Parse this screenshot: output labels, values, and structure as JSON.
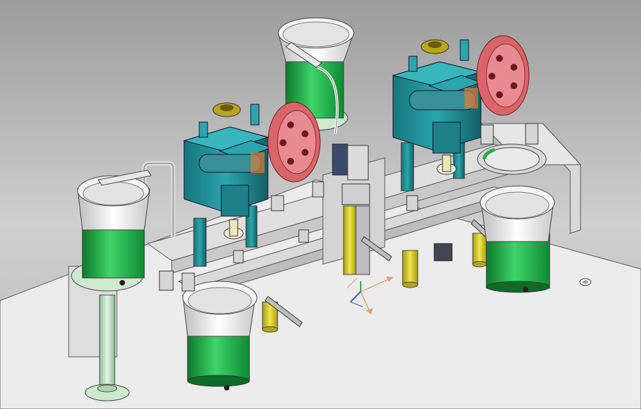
{
  "viewport": {
    "background_top": "#9c9c9c",
    "background_bottom": "#b9b9b9"
  },
  "colors": {
    "base_plate": "#ececec",
    "frame_rail": "#dcdcdc",
    "bowl_green": "#22b84a",
    "bowl_rim": "#f2f2f2",
    "press_body": "#1f8f96",
    "flywheel": "#d9646a",
    "cylinder_yellow": "#e0d22a",
    "pale_green": "#bfe3c4"
  },
  "triad": {
    "x_axis_color": "#d9a27a",
    "y_axis_color": "#3b5bd9",
    "z_axis_color": "#2aa84a"
  }
}
